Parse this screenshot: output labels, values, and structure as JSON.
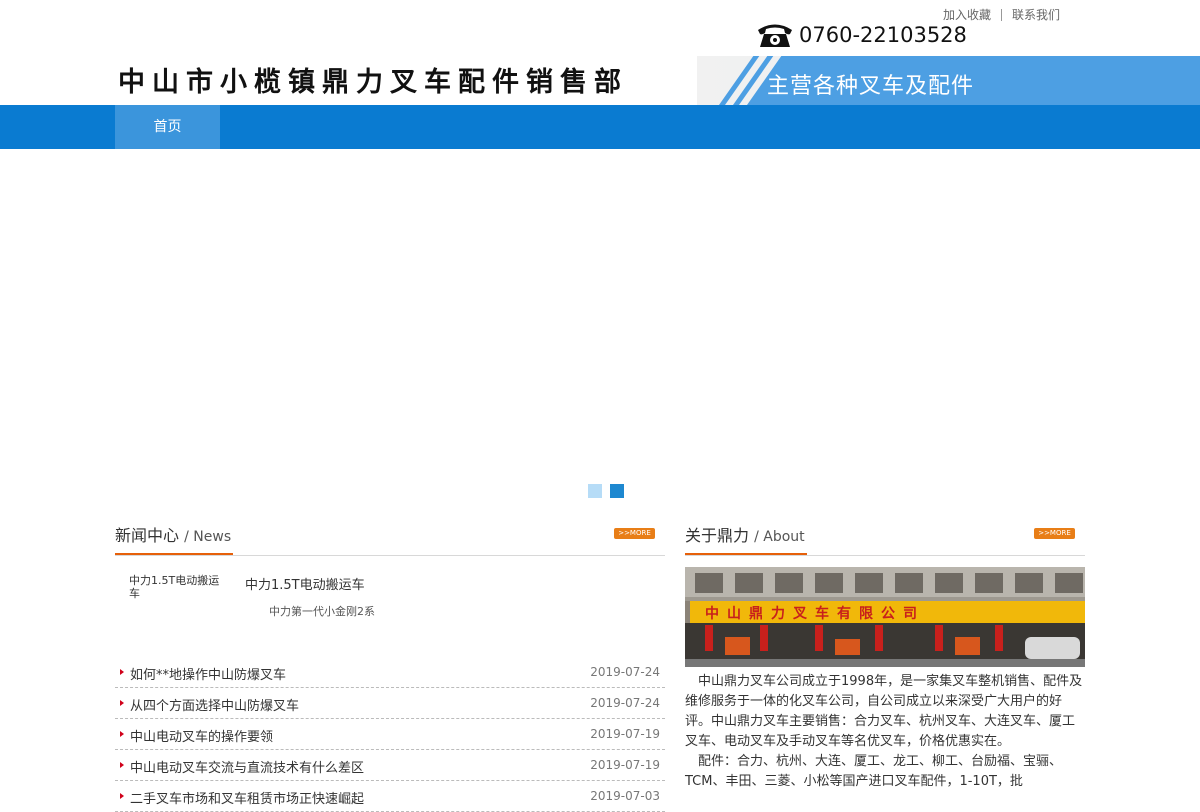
{
  "header": {
    "toplinks": {
      "bookmark": "加入收藏",
      "contact": "联系我们"
    },
    "phone": "0760-22103528",
    "company_name": "中山市小榄镇鼎力叉车配件销售部",
    "slogan": "主营各种叉车及配件",
    "sign_text": "中山鼎力叉车有限公司"
  },
  "nav": {
    "items": [
      {
        "label": "首页"
      }
    ]
  },
  "slider": {
    "dots": 2,
    "active_index": 1
  },
  "news": {
    "title": "新闻中心",
    "title_en": "/ News",
    "more": ">>MORE",
    "feature": {
      "image_alt": "中力1.5T电动搬运车",
      "title": "中力1.5T电动搬运车",
      "desc": "中力第一代小金刚2系"
    },
    "items": [
      {
        "title": "如何**地操作中山防爆叉车",
        "date": "2019-07-24"
      },
      {
        "title": "从四个方面选择中山防爆叉车",
        "date": "2019-07-24"
      },
      {
        "title": "中山电动叉车的操作要领",
        "date": "2019-07-19"
      },
      {
        "title": "中山电动叉车交流与直流技术有什么差区",
        "date": "2019-07-19"
      },
      {
        "title": "二手叉车市场和叉车租赁市场正快速崛起",
        "date": "2019-07-03"
      }
    ]
  },
  "about": {
    "title": "关于鼎力",
    "title_en": "/ About",
    "more": ">>MORE",
    "paragraph1": "中山鼎力叉车公司成立于1998年，是一家集叉车整机销售、配件及维修服务于一体的化叉车公司，自公司成立以来深受广大用户的好评。中山鼎力叉车主要销售：合力叉车、杭州叉车、大连叉车、厦工叉车、电动叉车及手动叉车等名优叉车，价格优惠实在。",
    "paragraph2": "配件：合力、杭州、大连、厦工、龙工、柳工、台励福、宝骊、TCM、丰田、三菱、小松等国产进口叉车配件，1-10T，批"
  },
  "colors": {
    "nav_blue": "#0a7bd1",
    "accent_orange": "#e6600a",
    "dot_active": "#1e88d0",
    "dot_inactive": "#b6dcf7"
  }
}
